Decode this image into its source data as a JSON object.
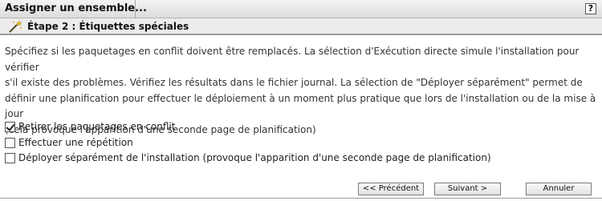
{
  "header": {
    "title": "Assigner un ensemble...",
    "help_label": "?"
  },
  "step": {
    "icon": "magic-wand-icon",
    "title": "Étape 2 : Étiquettes spéciales"
  },
  "description": [
    "Spécifiez si les paquetages en conflit doivent être remplacés. La sélection d'Exécution directe simule l'installation pour vérifier",
    "s'il existe des problèmes. Vérifiez les résultats dans le fichier journal. La sélection de \"Déployer séparément\" permet de",
    "définir une planification pour effectuer le déploiement à un moment plus pratique que lors de l'installation ou de la mise à jour",
    "(cela provoque l'apparition d'une seconde page de planification)"
  ],
  "options": [
    {
      "label": "Retirer les paquetages en conflit",
      "checked": true
    },
    {
      "label": "Effectuer une répétition",
      "checked": false
    },
    {
      "label": "Déployer séparément de l'installation (provoque l'apparition d'une seconde page de planification)",
      "checked": false
    }
  ],
  "buttons": {
    "previous": "<< Précédent",
    "next": "Suivant >",
    "cancel": "Annuler"
  }
}
